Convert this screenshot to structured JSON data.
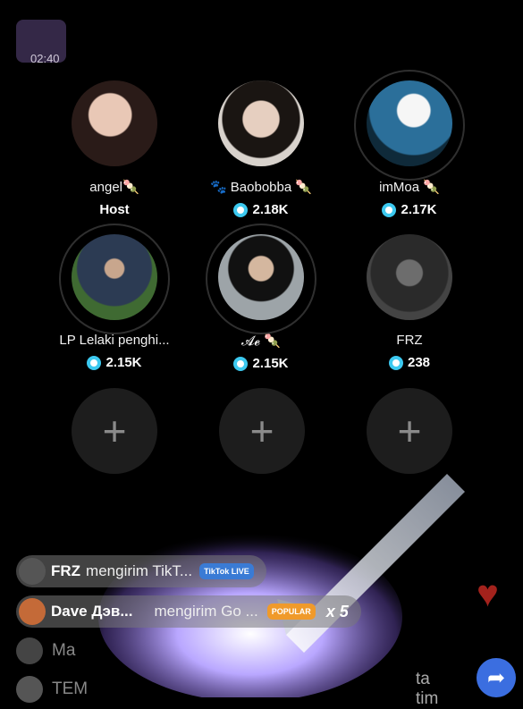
{
  "status": {
    "time": "02:40"
  },
  "seats": [
    {
      "name": "angel🍡",
      "role": "Host",
      "score": ""
    },
    {
      "name": "🐾 Baobobba 🍡",
      "role": "",
      "score": "2.18K"
    },
    {
      "name": "imMoa 🍡",
      "role": "",
      "score": "2.17K"
    },
    {
      "name": "LP Lelaki penghi...",
      "role": "",
      "score": "2.15K"
    },
    {
      "name": "𝓐𝓮 🍡",
      "role": "",
      "score": "2.15K"
    },
    {
      "name": "FRZ",
      "role": "",
      "score": "238"
    }
  ],
  "add_seat_symbol": "+",
  "gifts": [
    {
      "user": "FRZ",
      "text": "mengirim TikT...",
      "badge": "TikTok LIVE"
    },
    {
      "user": "Dave Дэв...",
      "text": "mengirim Go ...",
      "badge": "POPULAR",
      "count": "x 5"
    }
  ],
  "comments": [
    {
      "user": "Ma"
    },
    {
      "user": "TEM",
      "text": "ta tim"
    }
  ],
  "colors": {
    "accent": "#3cc9f0",
    "heart": "#a3221c",
    "share": "#3b6ee0"
  },
  "icons": {
    "heart": "heart-icon",
    "share": "share-icon"
  }
}
